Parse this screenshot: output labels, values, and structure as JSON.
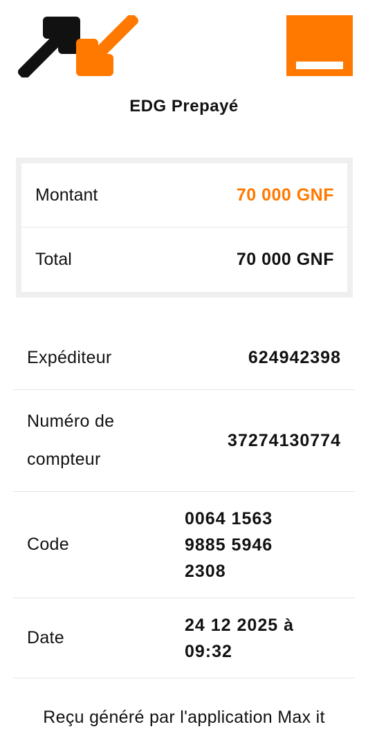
{
  "brand": {
    "accent_color": "#ff7900",
    "logo_icon": "max-it-arrows-icon",
    "operator_logo_icon": "orange-square-logo-icon"
  },
  "receipt": {
    "title": "EDG Prepayé",
    "amount": {
      "montant_label": "Montant",
      "montant_value": "70 000 GNF",
      "total_label": "Total",
      "total_value": "70 000 GNF"
    },
    "details": {
      "expediteur_label": "Expéditeur",
      "expediteur_value": "624942398",
      "compteur_label": "Numéro de compteur",
      "compteur_value": "37274130774",
      "code_label": "Code",
      "code_value": "0064 1563 9885 5946 2308",
      "date_label": "Date",
      "date_value": "24 12 2025 à 09:32"
    },
    "footer": "Reçu généré par l'application Max it"
  }
}
